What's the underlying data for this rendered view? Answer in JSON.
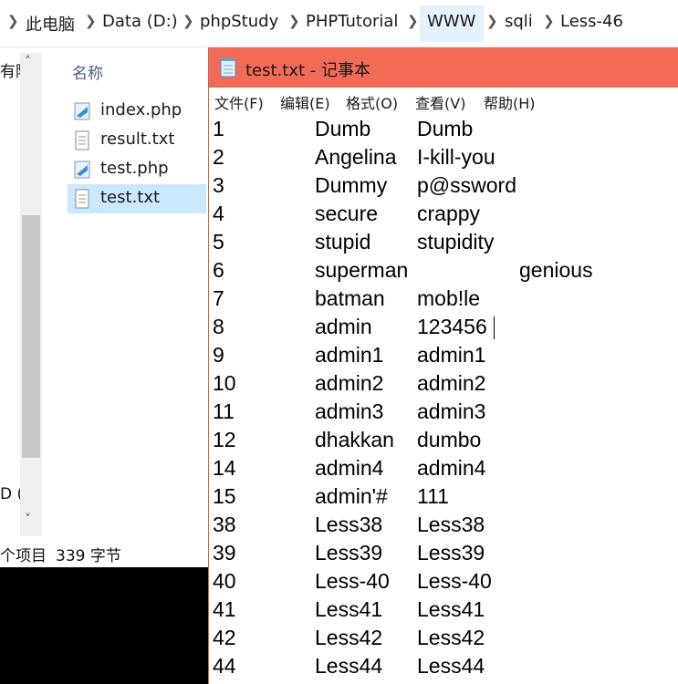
{
  "address_bar": {
    "crumbs": [
      "此电脑",
      "Data (D:)",
      "phpStudy",
      "PHPTutorial",
      "WWW",
      "sqli",
      "Less-46"
    ]
  },
  "nav": {
    "item_top": "有陈",
    "item_bottom": "D ("
  },
  "file_list": {
    "header": "名称",
    "files": [
      {
        "name": "index.php",
        "icon": "php-file-icon",
        "selected": false
      },
      {
        "name": "result.txt",
        "icon": "text-file-icon",
        "selected": false
      },
      {
        "name": "test.php",
        "icon": "php-file-icon",
        "selected": false
      },
      {
        "name": "test.txt",
        "icon": "text-file-icon",
        "selected": true
      }
    ]
  },
  "status_bar": {
    "count": "个项目",
    "size": "339 字节"
  },
  "notepad": {
    "title": "test.txt - 记事本",
    "accent": "#f26b57",
    "menu": [
      "文件(F)",
      "编辑(E)",
      "格式(O)",
      "查看(V)",
      "帮助(H)"
    ],
    "rows": [
      {
        "id": "1",
        "user": "Dumb",
        "pass": "Dumb"
      },
      {
        "id": "2",
        "user": "Angelina",
        "pass": "I-kill-you"
      },
      {
        "id": "3",
        "user": "Dummy",
        "pass": "p@ssword"
      },
      {
        "id": "4",
        "user": "secure",
        "pass": "crappy"
      },
      {
        "id": "5",
        "user": "stupid",
        "pass": "stupidity"
      },
      {
        "id": "6",
        "user": "superman",
        "pass": "genious"
      },
      {
        "id": "7",
        "user": "batman",
        "pass": "mob!le"
      },
      {
        "id": "8",
        "user": "admin",
        "pass": "123456"
      },
      {
        "id": "9",
        "user": "admin1",
        "pass": "admin1"
      },
      {
        "id": "10",
        "user": "admin2",
        "pass": "admin2"
      },
      {
        "id": "11",
        "user": "admin3",
        "pass": "admin3"
      },
      {
        "id": "12",
        "user": "dhakkan",
        "pass": "dumbo"
      },
      {
        "id": "14",
        "user": "admin4",
        "pass": "admin4"
      },
      {
        "id": "15",
        "user": "admin'#",
        "pass": "111"
      },
      {
        "id": "38",
        "user": "Less38",
        "pass": "Less38"
      },
      {
        "id": "39",
        "user": "Less39",
        "pass": "Less39"
      },
      {
        "id": "40",
        "user": "Less-40",
        "pass": "Less-40"
      },
      {
        "id": "41",
        "user": "Less41",
        "pass": "Less41"
      },
      {
        "id": "42",
        "user": "Less42",
        "pass": "Less42"
      },
      {
        "id": "44",
        "user": "Less44",
        "pass": "Less44"
      }
    ]
  }
}
